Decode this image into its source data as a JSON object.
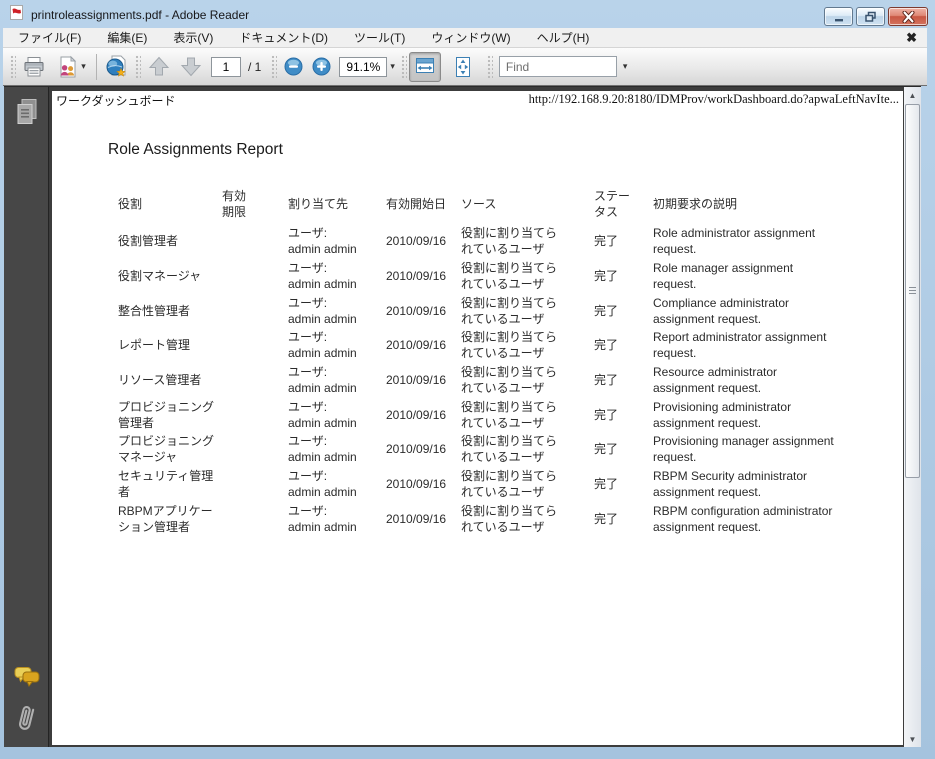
{
  "window": {
    "title": "printroleassignments.pdf - Adobe Reader"
  },
  "menu_bar": {
    "items": [
      "ファイル(F)",
      "編集(E)",
      "表示(V)",
      "ドキュメント(D)",
      "ツール(T)",
      "ウィンドウ(W)",
      "ヘルプ(H)"
    ],
    "close_glyph": "✖"
  },
  "toolbar": {
    "page_field_value": "1",
    "page_total_label": "/ 1",
    "zoom_level": "91.1%",
    "find_placeholder": "Find",
    "dropdown_glyph": "▾"
  },
  "scrollbar": {
    "up_glyph": "▲",
    "down_glyph": "▼"
  },
  "document": {
    "page_header_left": "ワークダッシュボード",
    "page_header_right": "http://192.168.9.20:8180/IDMProv/workDashboard.do?apwaLeftNavIte...",
    "report_title": "Role Assignments Report",
    "table": {
      "headers": {
        "role": "役割",
        "expiry": "有効期限",
        "assignee": "割り当て先",
        "start_date": "有効開始日",
        "source": "ソース",
        "status": "ステータス",
        "description": "初期要求の説明"
      },
      "rows": [
        {
          "role": "役割管理者",
          "assignee_label": "ユーザ:",
          "assignee_name": "admin admin",
          "start_date": "2010/09/16",
          "source": "役割に割り当てられているユーザ",
          "status": "完了",
          "description": "Role administrator assignment request."
        },
        {
          "role": "役割マネージャ",
          "assignee_label": "ユーザ:",
          "assignee_name": "admin admin",
          "start_date": "2010/09/16",
          "source": "役割に割り当てられているユーザ",
          "status": "完了",
          "description": "Role manager assignment request."
        },
        {
          "role": "整合性管理者",
          "assignee_label": "ユーザ:",
          "assignee_name": "admin admin",
          "start_date": "2010/09/16",
          "source": "役割に割り当てられているユーザ",
          "status": "完了",
          "description": "Compliance administrator assignment request."
        },
        {
          "role": "レポート管理",
          "assignee_label": "ユーザ:",
          "assignee_name": "admin admin",
          "start_date": "2010/09/16",
          "source": "役割に割り当てられているユーザ",
          "status": "完了",
          "description": "Report administrator assignment request."
        },
        {
          "role": "リソース管理者",
          "assignee_label": "ユーザ:",
          "assignee_name": "admin admin",
          "start_date": "2010/09/16",
          "source": "役割に割り当てられているユーザ",
          "status": "完了",
          "description": "Resource administrator assignment request."
        },
        {
          "role": "プロビジョニング管理者",
          "assignee_label": "ユーザ:",
          "assignee_name": "admin admin",
          "start_date": "2010/09/16",
          "source": "役割に割り当てられているユーザ",
          "status": "完了",
          "description": "Provisioning administrator assignment request."
        },
        {
          "role": "プロビジョニングマネージャ",
          "assignee_label": "ユーザ:",
          "assignee_name": "admin admin",
          "start_date": "2010/09/16",
          "source": "役割に割り当てられているユーザ",
          "status": "完了",
          "description": "Provisioning manager assignment request."
        },
        {
          "role": "セキュリティ管理者",
          "assignee_label": "ユーザ:",
          "assignee_name": "admin admin",
          "start_date": "2010/09/16",
          "source": "役割に割り当てられているユーザ",
          "status": "完了",
          "description": "RBPM Security administrator assignment request."
        },
        {
          "role": "RBPMアプリケーション管理者",
          "assignee_label": "ユーザ:",
          "assignee_name": "admin admin",
          "start_date": "2010/09/16",
          "source": "役割に割り当てられているユーザ",
          "status": "完了",
          "description": "RBPM configuration administrator assignment request."
        }
      ]
    }
  }
}
